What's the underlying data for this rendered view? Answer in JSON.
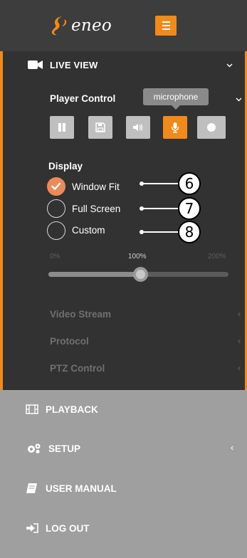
{
  "header": {
    "brand": "eneo",
    "brand_color": "#f18a1c",
    "menu_icon": "hamburger-icon"
  },
  "live_view": {
    "title": "LIVE VIEW",
    "icon": "video-camera-icon",
    "expanded": true,
    "player_control": {
      "title": "Player Control",
      "tooltip": "microphone",
      "buttons": [
        {
          "icon": "pause-icon",
          "active": false
        },
        {
          "icon": "save-icon",
          "active": false
        },
        {
          "icon": "speaker-icon",
          "active": false
        },
        {
          "icon": "microphone-icon",
          "active": true
        },
        {
          "icon": "record-icon",
          "active": false
        }
      ]
    },
    "display": {
      "title": "Display",
      "options": [
        {
          "label": "Window Fit",
          "checked": true,
          "callout": "6"
        },
        {
          "label": "Full Screen",
          "checked": false,
          "callout": "7"
        },
        {
          "label": "Custom",
          "checked": false,
          "callout": "8"
        }
      ],
      "scale": {
        "min_label": "0%",
        "mid_label": "100%",
        "max_label": "200%",
        "value_percent": 100
      }
    },
    "sub_items": [
      {
        "label": "Video Stream"
      },
      {
        "label": "Protocol"
      },
      {
        "label": "PTZ Control"
      }
    ]
  },
  "nav": {
    "items": [
      {
        "label": "PLAYBACK",
        "icon": "film-icon"
      },
      {
        "label": "SETUP",
        "icon": "gears-icon"
      },
      {
        "label": "USER MANUAL",
        "icon": "book-icon"
      },
      {
        "label": "LOG OUT",
        "icon": "logout-icon"
      }
    ]
  },
  "colors": {
    "accent": "#f18a1c",
    "panel": "#323232",
    "nav": "#9f9f9f"
  }
}
